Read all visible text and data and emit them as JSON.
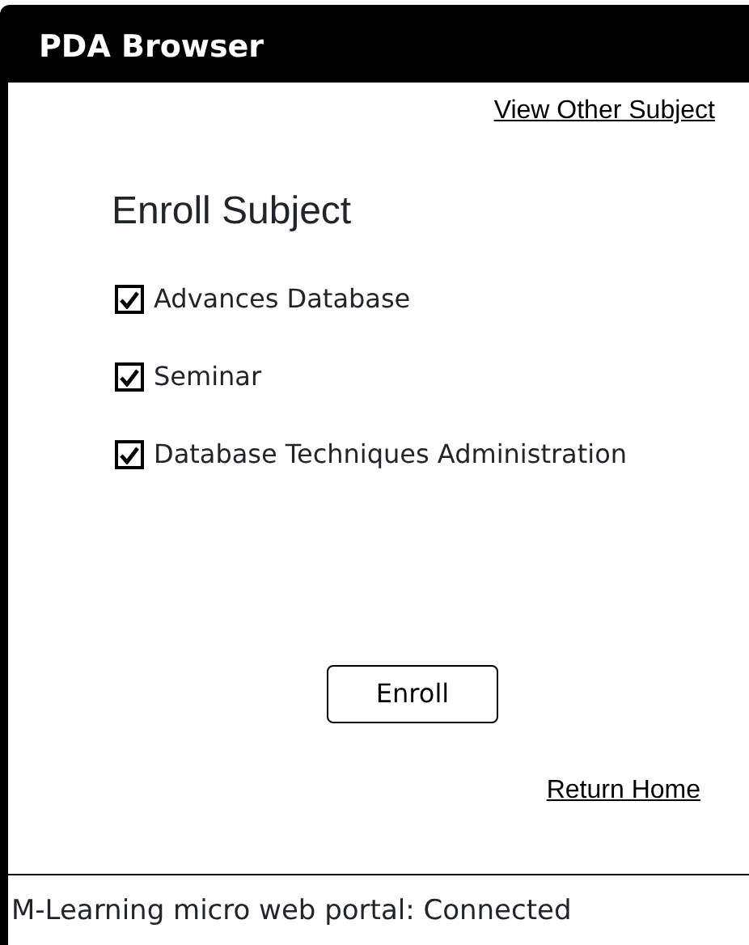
{
  "window": {
    "title": "PDA Browser"
  },
  "links": [
    {
      "label": "View Other Subject"
    }
  ],
  "heading": "Enroll Subject",
  "subjects": [
    {
      "label": "Advances Database",
      "checked": true
    },
    {
      "label": "Seminar",
      "checked": true
    },
    {
      "label": "Database Techniques Administration",
      "checked": true
    }
  ],
  "button": "Enroll",
  "footer_link": "Return Home",
  "status_bar": "M-Learning micro web portal: Connected"
}
